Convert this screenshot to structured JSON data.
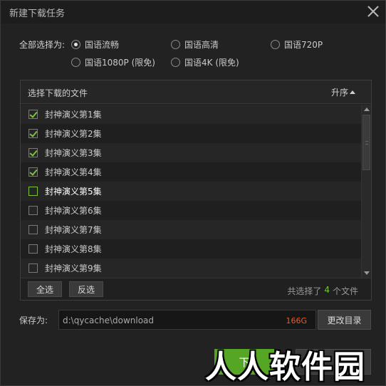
{
  "window": {
    "title": "新建下载任务"
  },
  "quality": {
    "label": "全部选择为:",
    "options": [
      {
        "label": "国语流畅",
        "checked": true
      },
      {
        "label": "国语高清",
        "checked": false
      },
      {
        "label": "国语720P",
        "checked": false
      },
      {
        "label": "国语1080P (限免)",
        "checked": false
      },
      {
        "label": "国语4K (限免)",
        "checked": false
      }
    ]
  },
  "files": {
    "header": "选择下载的文件",
    "sort_label": "升序",
    "items": [
      {
        "name": "封神演义第1集",
        "checked": true
      },
      {
        "name": "封神演义第2集",
        "checked": true
      },
      {
        "name": "封神演义第3集",
        "checked": true
      },
      {
        "name": "封神演义第4集",
        "checked": true
      },
      {
        "name": "封神演义第5集",
        "checked": false
      },
      {
        "name": "封神演义第6集",
        "checked": false
      },
      {
        "name": "封神演义第7集",
        "checked": false
      },
      {
        "name": "封神演义第8集",
        "checked": false
      },
      {
        "name": "封神演义第9集",
        "checked": false
      }
    ],
    "select_all": "全选",
    "invert": "反选",
    "selected_prefix": "共选择了",
    "selected_count": "4",
    "selected_suffix": "个文件"
  },
  "save": {
    "label": "保存为:",
    "path": "d:\\qycache\\download",
    "free_space": "166G",
    "change_dir": "更改目录"
  },
  "actions": {
    "download": "下"
  },
  "watermark": "人人软件园",
  "colors": {
    "accent": "#7cc23c",
    "space": "#f05a1f",
    "button_green": "#55a624"
  }
}
